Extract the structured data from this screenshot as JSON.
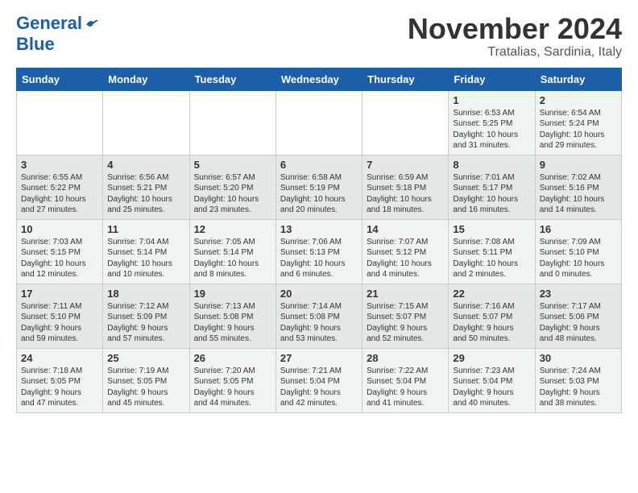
{
  "header": {
    "logo_general": "General",
    "logo_blue": "Blue",
    "month_title": "November 2024",
    "location": "Tratalias, Sardinia, Italy"
  },
  "weekdays": [
    "Sunday",
    "Monday",
    "Tuesday",
    "Wednesday",
    "Thursday",
    "Friday",
    "Saturday"
  ],
  "rows": [
    [
      {
        "day": "",
        "info": ""
      },
      {
        "day": "",
        "info": ""
      },
      {
        "day": "",
        "info": ""
      },
      {
        "day": "",
        "info": ""
      },
      {
        "day": "",
        "info": ""
      },
      {
        "day": "1",
        "info": "Sunrise: 6:53 AM\nSunset: 5:25 PM\nDaylight: 10 hours\nand 31 minutes."
      },
      {
        "day": "2",
        "info": "Sunrise: 6:54 AM\nSunset: 5:24 PM\nDaylight: 10 hours\nand 29 minutes."
      }
    ],
    [
      {
        "day": "3",
        "info": "Sunrise: 6:55 AM\nSunset: 5:22 PM\nDaylight: 10 hours\nand 27 minutes."
      },
      {
        "day": "4",
        "info": "Sunrise: 6:56 AM\nSunset: 5:21 PM\nDaylight: 10 hours\nand 25 minutes."
      },
      {
        "day": "5",
        "info": "Sunrise: 6:57 AM\nSunset: 5:20 PM\nDaylight: 10 hours\nand 23 minutes."
      },
      {
        "day": "6",
        "info": "Sunrise: 6:58 AM\nSunset: 5:19 PM\nDaylight: 10 hours\nand 20 minutes."
      },
      {
        "day": "7",
        "info": "Sunrise: 6:59 AM\nSunset: 5:18 PM\nDaylight: 10 hours\nand 18 minutes."
      },
      {
        "day": "8",
        "info": "Sunrise: 7:01 AM\nSunset: 5:17 PM\nDaylight: 10 hours\nand 16 minutes."
      },
      {
        "day": "9",
        "info": "Sunrise: 7:02 AM\nSunset: 5:16 PM\nDaylight: 10 hours\nand 14 minutes."
      }
    ],
    [
      {
        "day": "10",
        "info": "Sunrise: 7:03 AM\nSunset: 5:15 PM\nDaylight: 10 hours\nand 12 minutes."
      },
      {
        "day": "11",
        "info": "Sunrise: 7:04 AM\nSunset: 5:14 PM\nDaylight: 10 hours\nand 10 minutes."
      },
      {
        "day": "12",
        "info": "Sunrise: 7:05 AM\nSunset: 5:14 PM\nDaylight: 10 hours\nand 8 minutes."
      },
      {
        "day": "13",
        "info": "Sunrise: 7:06 AM\nSunset: 5:13 PM\nDaylight: 10 hours\nand 6 minutes."
      },
      {
        "day": "14",
        "info": "Sunrise: 7:07 AM\nSunset: 5:12 PM\nDaylight: 10 hours\nand 4 minutes."
      },
      {
        "day": "15",
        "info": "Sunrise: 7:08 AM\nSunset: 5:11 PM\nDaylight: 10 hours\nand 2 minutes."
      },
      {
        "day": "16",
        "info": "Sunrise: 7:09 AM\nSunset: 5:10 PM\nDaylight: 10 hours\nand 0 minutes."
      }
    ],
    [
      {
        "day": "17",
        "info": "Sunrise: 7:11 AM\nSunset: 5:10 PM\nDaylight: 9 hours\nand 59 minutes."
      },
      {
        "day": "18",
        "info": "Sunrise: 7:12 AM\nSunset: 5:09 PM\nDaylight: 9 hours\nand 57 minutes."
      },
      {
        "day": "19",
        "info": "Sunrise: 7:13 AM\nSunset: 5:08 PM\nDaylight: 9 hours\nand 55 minutes."
      },
      {
        "day": "20",
        "info": "Sunrise: 7:14 AM\nSunset: 5:08 PM\nDaylight: 9 hours\nand 53 minutes."
      },
      {
        "day": "21",
        "info": "Sunrise: 7:15 AM\nSunset: 5:07 PM\nDaylight: 9 hours\nand 52 minutes."
      },
      {
        "day": "22",
        "info": "Sunrise: 7:16 AM\nSunset: 5:07 PM\nDaylight: 9 hours\nand 50 minutes."
      },
      {
        "day": "23",
        "info": "Sunrise: 7:17 AM\nSunset: 5:06 PM\nDaylight: 9 hours\nand 48 minutes."
      }
    ],
    [
      {
        "day": "24",
        "info": "Sunrise: 7:18 AM\nSunset: 5:05 PM\nDaylight: 9 hours\nand 47 minutes."
      },
      {
        "day": "25",
        "info": "Sunrise: 7:19 AM\nSunset: 5:05 PM\nDaylight: 9 hours\nand 45 minutes."
      },
      {
        "day": "26",
        "info": "Sunrise: 7:20 AM\nSunset: 5:05 PM\nDaylight: 9 hours\nand 44 minutes."
      },
      {
        "day": "27",
        "info": "Sunrise: 7:21 AM\nSunset: 5:04 PM\nDaylight: 9 hours\nand 42 minutes."
      },
      {
        "day": "28",
        "info": "Sunrise: 7:22 AM\nSunset: 5:04 PM\nDaylight: 9 hours\nand 41 minutes."
      },
      {
        "day": "29",
        "info": "Sunrise: 7:23 AM\nSunset: 5:04 PM\nDaylight: 9 hours\nand 40 minutes."
      },
      {
        "day": "30",
        "info": "Sunrise: 7:24 AM\nSunset: 5:03 PM\nDaylight: 9 hours\nand 38 minutes."
      }
    ]
  ]
}
